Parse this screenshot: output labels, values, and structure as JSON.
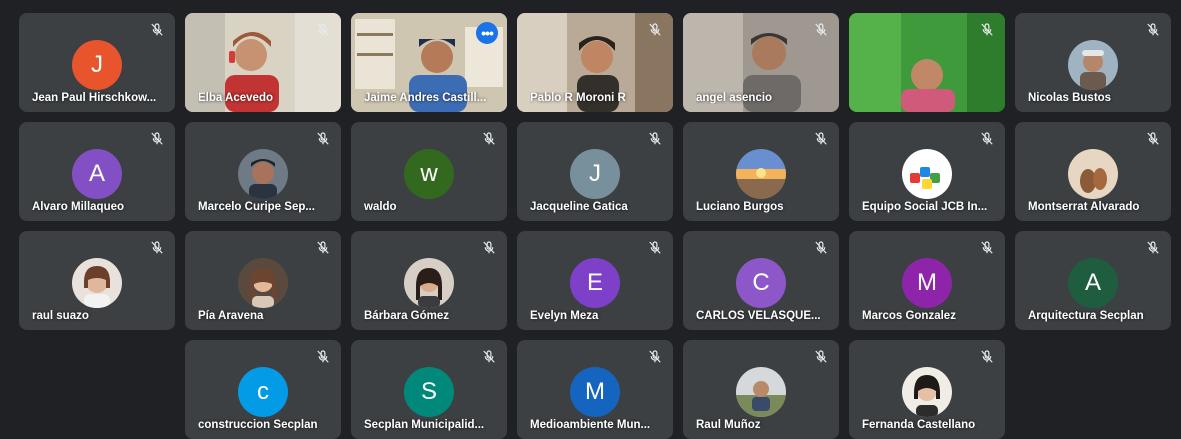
{
  "participants": [
    {
      "name": "Jean Paul Hirschkow...",
      "initial": "J",
      "color": "#e8542b",
      "kind": "initial",
      "icon": "mic-off-icon"
    },
    {
      "name": "Elba Acevedo",
      "kind": "video",
      "icon": "mic-off-icon"
    },
    {
      "name": "Jaime Andres Castill...",
      "kind": "video",
      "active": true,
      "icon": "more-options-icon"
    },
    {
      "name": "Pablo R Moroni R",
      "kind": "video",
      "icon": "mic-off-icon"
    },
    {
      "name": "angel asencio",
      "kind": "video",
      "icon": "mic-off-icon"
    },
    {
      "name": "",
      "kind": "video",
      "icon": "mic-off-icon"
    },
    {
      "name": "Nicolas Bustos",
      "kind": "photo",
      "icon": "mic-off-icon"
    },
    {
      "name": "Alvaro Millaqueo",
      "initial": "A",
      "color": "#8250c4",
      "kind": "initial",
      "icon": "mic-off-icon"
    },
    {
      "name": "Marcelo Curipe Sep...",
      "kind": "photo",
      "icon": "mic-off-icon"
    },
    {
      "name": "waldo",
      "initial": "w",
      "color": "#33691e",
      "kind": "initial",
      "icon": "mic-off-icon"
    },
    {
      "name": "Jacqueline Gatica",
      "initial": "J",
      "color": "#78909c",
      "kind": "initial",
      "icon": "mic-off-icon"
    },
    {
      "name": "Luciano Burgos",
      "kind": "photo",
      "icon": "mic-off-icon"
    },
    {
      "name": "Equipo Social JCB In...",
      "kind": "photo",
      "icon": "mic-off-icon"
    },
    {
      "name": "Montserrat Alvarado",
      "kind": "photo",
      "icon": "mic-off-icon"
    },
    {
      "name": "raul suazo",
      "kind": "photo",
      "icon": "mic-off-icon"
    },
    {
      "name": "Pía Aravena",
      "kind": "photo",
      "icon": "mic-off-icon"
    },
    {
      "name": "Bárbara Gómez",
      "kind": "photo",
      "icon": "mic-off-icon"
    },
    {
      "name": "Evelyn Meza",
      "initial": "E",
      "color": "#7e3fc9",
      "kind": "initial",
      "icon": "mic-off-icon"
    },
    {
      "name": "CARLOS VELASQUE...",
      "initial": "C",
      "color": "#8e57c9",
      "kind": "initial",
      "icon": "mic-off-icon"
    },
    {
      "name": "Marcos Gonzalez",
      "initial": "M",
      "color": "#8e24aa",
      "kind": "initial",
      "icon": "mic-off-icon"
    },
    {
      "name": "Arquitectura Secplan",
      "initial": "A",
      "color": "#1e5e3e",
      "kind": "initial",
      "icon": "mic-off-icon"
    },
    {
      "name": "construccion Secplan",
      "initial": "c",
      "color": "#039be5",
      "kind": "initial",
      "icon": "mic-off-icon"
    },
    {
      "name": "Secplan Municipalid...",
      "initial": "S",
      "color": "#00897b",
      "kind": "initial",
      "icon": "mic-off-icon"
    },
    {
      "name": "Medioambiente Mun...",
      "initial": "M",
      "color": "#1565c0",
      "kind": "initial",
      "icon": "mic-off-icon"
    },
    {
      "name": "Raul Muñoz",
      "kind": "photo",
      "icon": "mic-off-icon"
    },
    {
      "name": "Fernanda Castellano",
      "kind": "photo",
      "icon": "mic-off-icon"
    }
  ]
}
